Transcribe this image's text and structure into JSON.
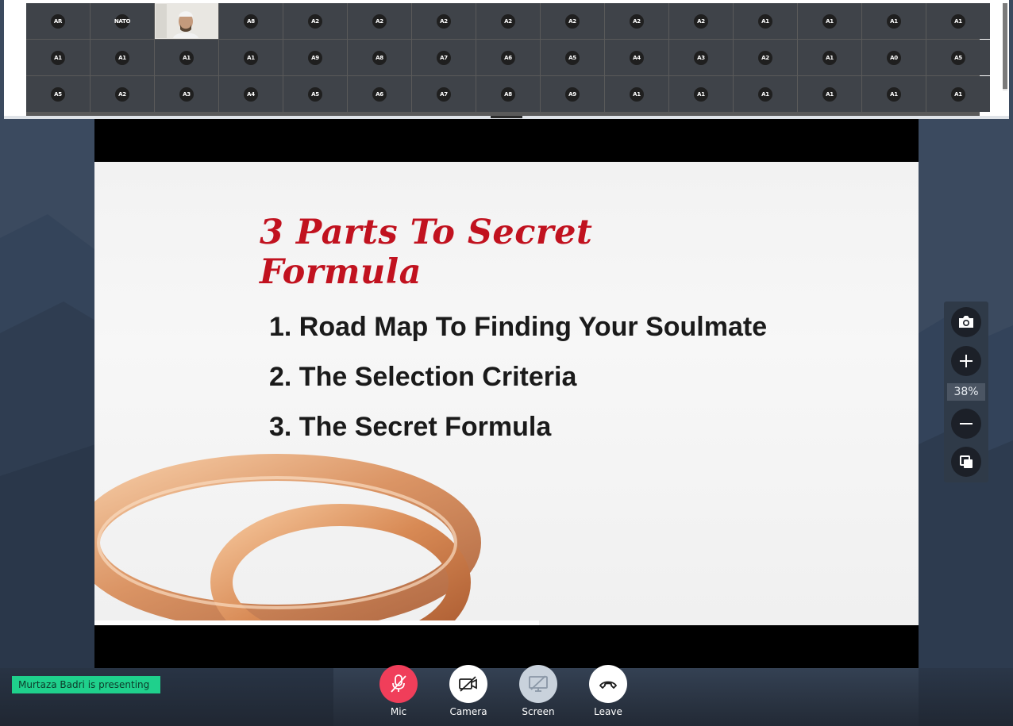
{
  "participants": [
    [
      "AR",
      "NATO",
      "",
      "A8",
      "A2",
      "A2",
      "A2",
      "A2",
      "A2",
      "A2",
      "A2",
      "A1",
      "A1",
      "A1",
      "A1"
    ],
    [
      "A1",
      "A1",
      "A1",
      "A1",
      "A9",
      "A8",
      "A7",
      "A6",
      "A5",
      "A4",
      "A3",
      "A2",
      "A1",
      "A0",
      "A5"
    ],
    [
      "A5",
      "A2",
      "A3",
      "A4",
      "A5",
      "A6",
      "A7",
      "A8",
      "A9",
      "A1",
      "A1",
      "A1",
      "A1",
      "A1",
      "A1"
    ]
  ],
  "slide": {
    "title": "3 Parts To Secret Formula",
    "items": [
      "1. Road Map To Finding Your Soulmate",
      "2. The Selection Criteria",
      "3. The Secret Formula"
    ]
  },
  "zoom": {
    "level": "38%",
    "icons": [
      "camera-icon",
      "plus-icon",
      "minus-icon",
      "copy-icon"
    ]
  },
  "status": {
    "presenting": "Murtaza Badri is presenting"
  },
  "controls": {
    "mic": "Mic",
    "camera": "Camera",
    "screen": "Screen",
    "leave": "Leave"
  },
  "colors": {
    "mic_off": "#f03e5a",
    "presenting_badge": "#1fd08c",
    "title_red": "#c1121f",
    "screen_disabled": "#c9d2dc"
  }
}
